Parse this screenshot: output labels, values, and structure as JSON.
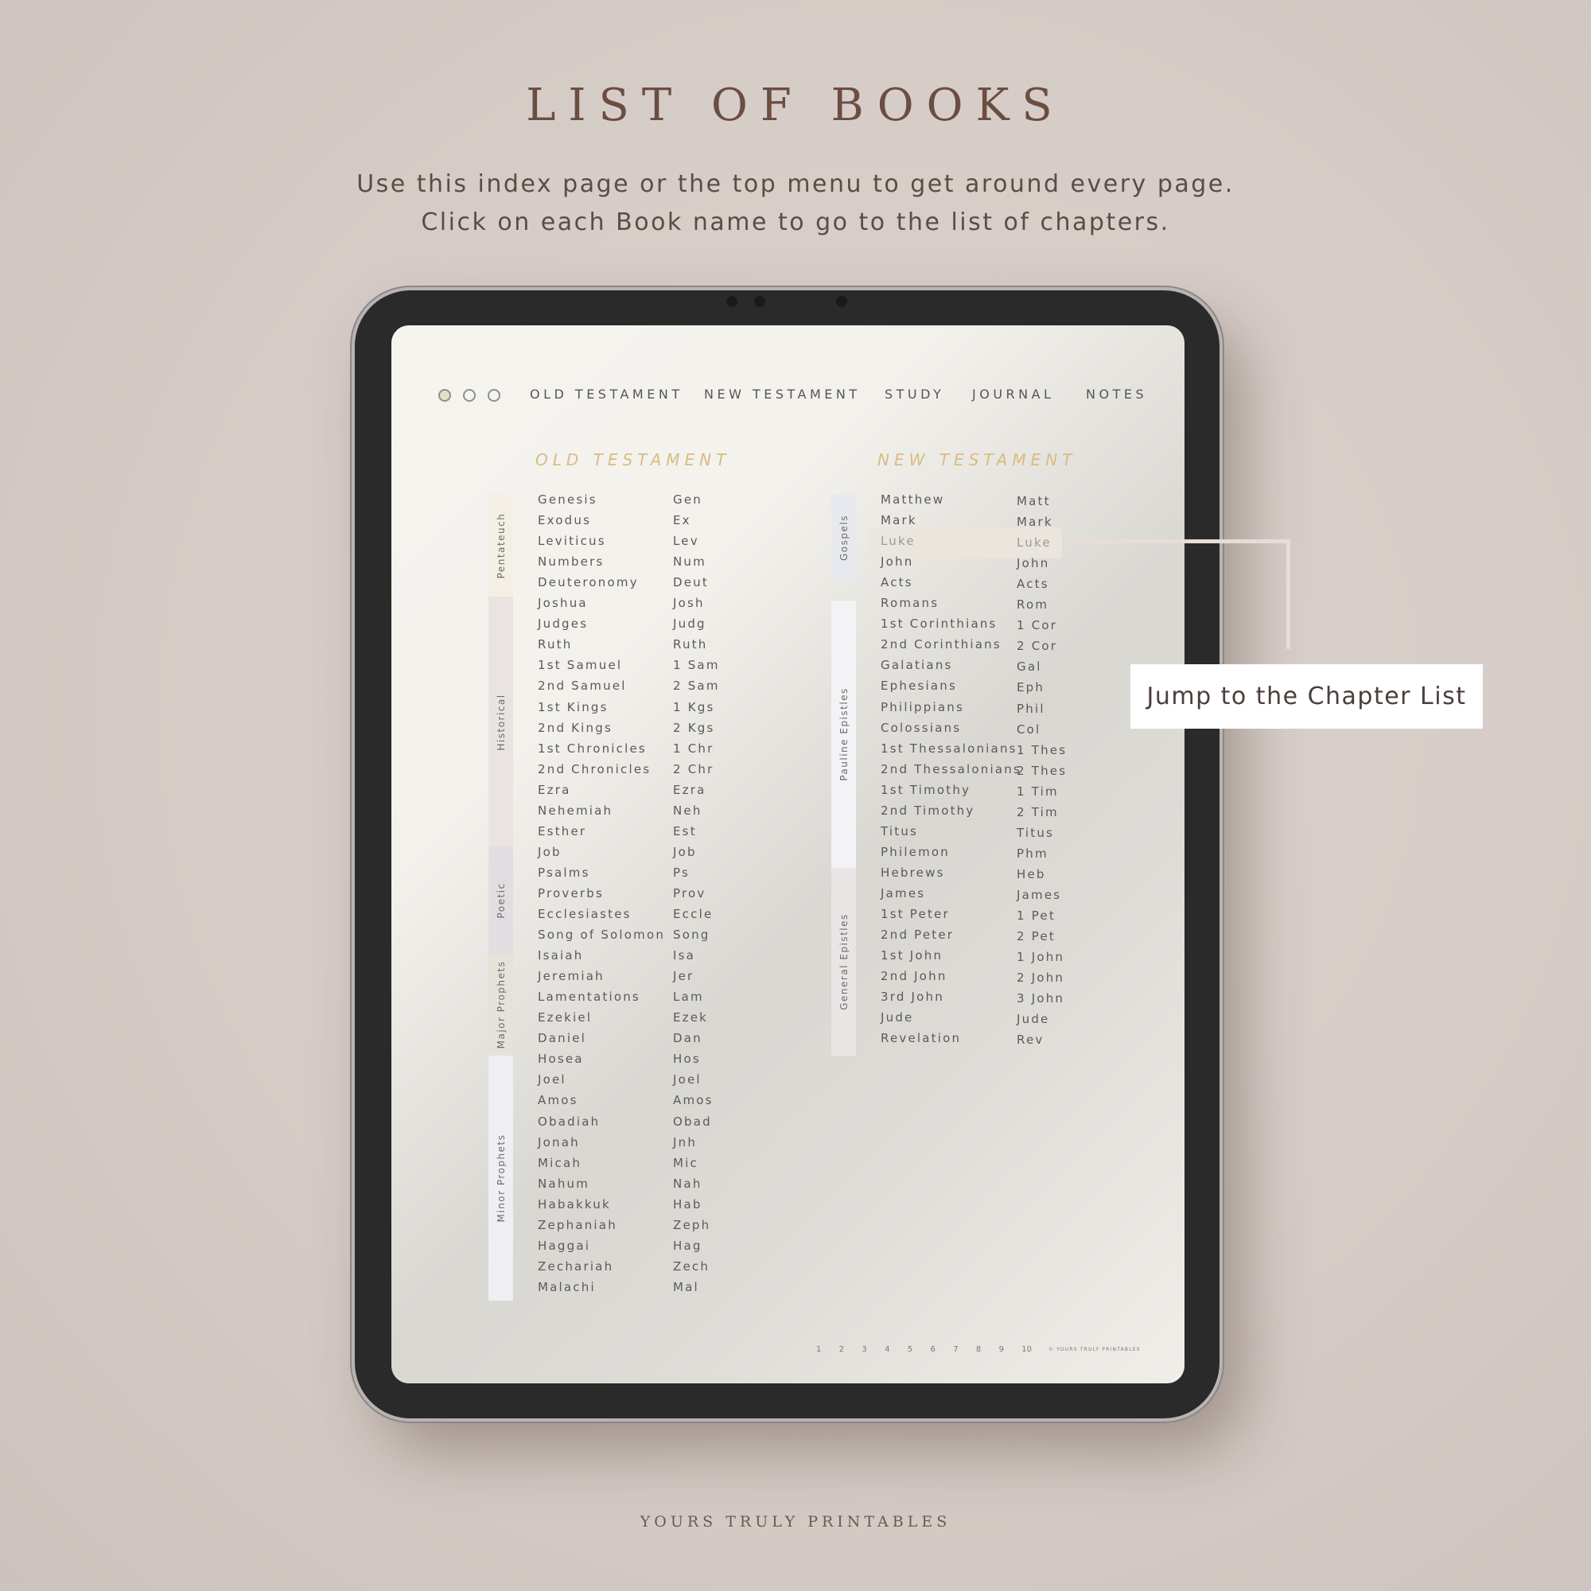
{
  "title": "LIST OF BOOKS",
  "subtitle": [
    "Use this index page or the top menu to get around every page.",
    "Click on each Book name to go to the list of chapters."
  ],
  "nav": {
    "items": [
      "OLD TESTAMENT",
      "NEW TESTAMENT",
      "STUDY",
      "JOURNAL",
      "NOTES"
    ]
  },
  "old_testament": {
    "heading": "OLD TESTAMENT",
    "categories": [
      {
        "label": "Pentateuch",
        "color": "#f3efe4"
      },
      {
        "label": "Historical",
        "color": "#e9e4e1"
      },
      {
        "label": "Poetic",
        "color": "#e2dde0"
      },
      {
        "label": "Major Prophets",
        "color": "#e6e2da"
      },
      {
        "label": "Minor Prophets",
        "color": "#eeeef3"
      }
    ],
    "books": [
      [
        "Genesis",
        "Gen"
      ],
      [
        "Exodus",
        "Ex"
      ],
      [
        "Leviticus",
        "Lev"
      ],
      [
        "Numbers",
        "Num"
      ],
      [
        "Deuteronomy",
        "Deut"
      ],
      [
        "Joshua",
        "Josh"
      ],
      [
        "Judges",
        "Judg"
      ],
      [
        "Ruth",
        "Ruth"
      ],
      [
        "1st Samuel",
        "1 Sam"
      ],
      [
        "2nd Samuel",
        "2 Sam"
      ],
      [
        "1st Kings",
        "1 Kgs"
      ],
      [
        "2nd Kings",
        "2 Kgs"
      ],
      [
        "1st Chronicles",
        "1 Chr"
      ],
      [
        "2nd Chronicles",
        "2 Chr"
      ],
      [
        "Ezra",
        "Ezra"
      ],
      [
        "Nehemiah",
        "Neh"
      ],
      [
        "Esther",
        "Est"
      ],
      [
        "Job",
        "Job"
      ],
      [
        "Psalms",
        "Ps"
      ],
      [
        "Proverbs",
        "Prov"
      ],
      [
        "Ecclesiastes",
        "Eccle"
      ],
      [
        "Song of Solomon",
        "Song"
      ],
      [
        "Isaiah",
        "Isa"
      ],
      [
        "Jeremiah",
        "Jer"
      ],
      [
        "Lamentations",
        "Lam"
      ],
      [
        "Ezekiel",
        "Ezek"
      ],
      [
        "Daniel",
        "Dan"
      ],
      [
        "Hosea",
        "Hos"
      ],
      [
        "Joel",
        "Joel"
      ],
      [
        "Amos",
        "Amos"
      ],
      [
        "Obadiah",
        "Obad"
      ],
      [
        "Jonah",
        "Jnh"
      ],
      [
        "Micah",
        "Mic"
      ],
      [
        "Nahum",
        "Nah"
      ],
      [
        "Habakkuk",
        "Hab"
      ],
      [
        "Zephaniah",
        "Zeph"
      ],
      [
        "Haggai",
        "Hag"
      ],
      [
        "Zechariah",
        "Zech"
      ],
      [
        "Malachi",
        "Mal"
      ]
    ]
  },
  "new_testament": {
    "heading": "NEW TESTAMENT",
    "categories": [
      {
        "label": "Gospels",
        "color": "#e8e9ee"
      },
      {
        "label": "Pauline Epistles",
        "color": "#f3f2f5"
      },
      {
        "label": "General Epistles",
        "color": "#e9e5e5"
      }
    ],
    "books": [
      [
        "Matthew",
        "Matt"
      ],
      [
        "Mark",
        "Mark"
      ],
      [
        "Luke",
        "Luke"
      ],
      [
        "John",
        "John"
      ],
      [
        "Acts",
        "Acts"
      ],
      [
        "Romans",
        "Rom"
      ],
      [
        "1st Corinthians",
        "1 Cor"
      ],
      [
        "2nd Corinthians",
        "2 Cor"
      ],
      [
        "Galatians",
        "Gal"
      ],
      [
        "Ephesians",
        "Eph"
      ],
      [
        "Philippians",
        "Phil"
      ],
      [
        "Colossians",
        "Col"
      ],
      [
        "1st Thessalonians",
        "1 Thes"
      ],
      [
        "2nd Thessalonians",
        "2 Thes"
      ],
      [
        "1st Timothy",
        "1 Tim"
      ],
      [
        "2nd Timothy",
        "2 Tim"
      ],
      [
        "Titus",
        "Titus"
      ],
      [
        "Philemon",
        "Phm"
      ],
      [
        "Hebrews",
        "Heb"
      ],
      [
        "James",
        "James"
      ],
      [
        "1st Peter",
        "1 Pet"
      ],
      [
        "2nd Peter",
        "2 Pet"
      ],
      [
        "1st John",
        "1 John"
      ],
      [
        "2nd John",
        "2 John"
      ],
      [
        "3rd John",
        "3 John"
      ],
      [
        "Jude",
        "Jude"
      ],
      [
        "Revelation",
        "Rev"
      ]
    ],
    "highlighted": "Luke"
  },
  "callout": "Jump to the Chapter List",
  "footer": {
    "pages": [
      "1",
      "2",
      "3",
      "4",
      "5",
      "6",
      "7",
      "8",
      "9",
      "10"
    ],
    "copyright": "© YOURS TRULY PRINTABLES"
  },
  "brand": "YOURS TRULY PRINTABLES",
  "colors": {
    "title": "#6a4e41",
    "heading_gold": "#d8bb84",
    "highlight": "#ebe5dd",
    "active_dot": "#e3e0c8"
  }
}
